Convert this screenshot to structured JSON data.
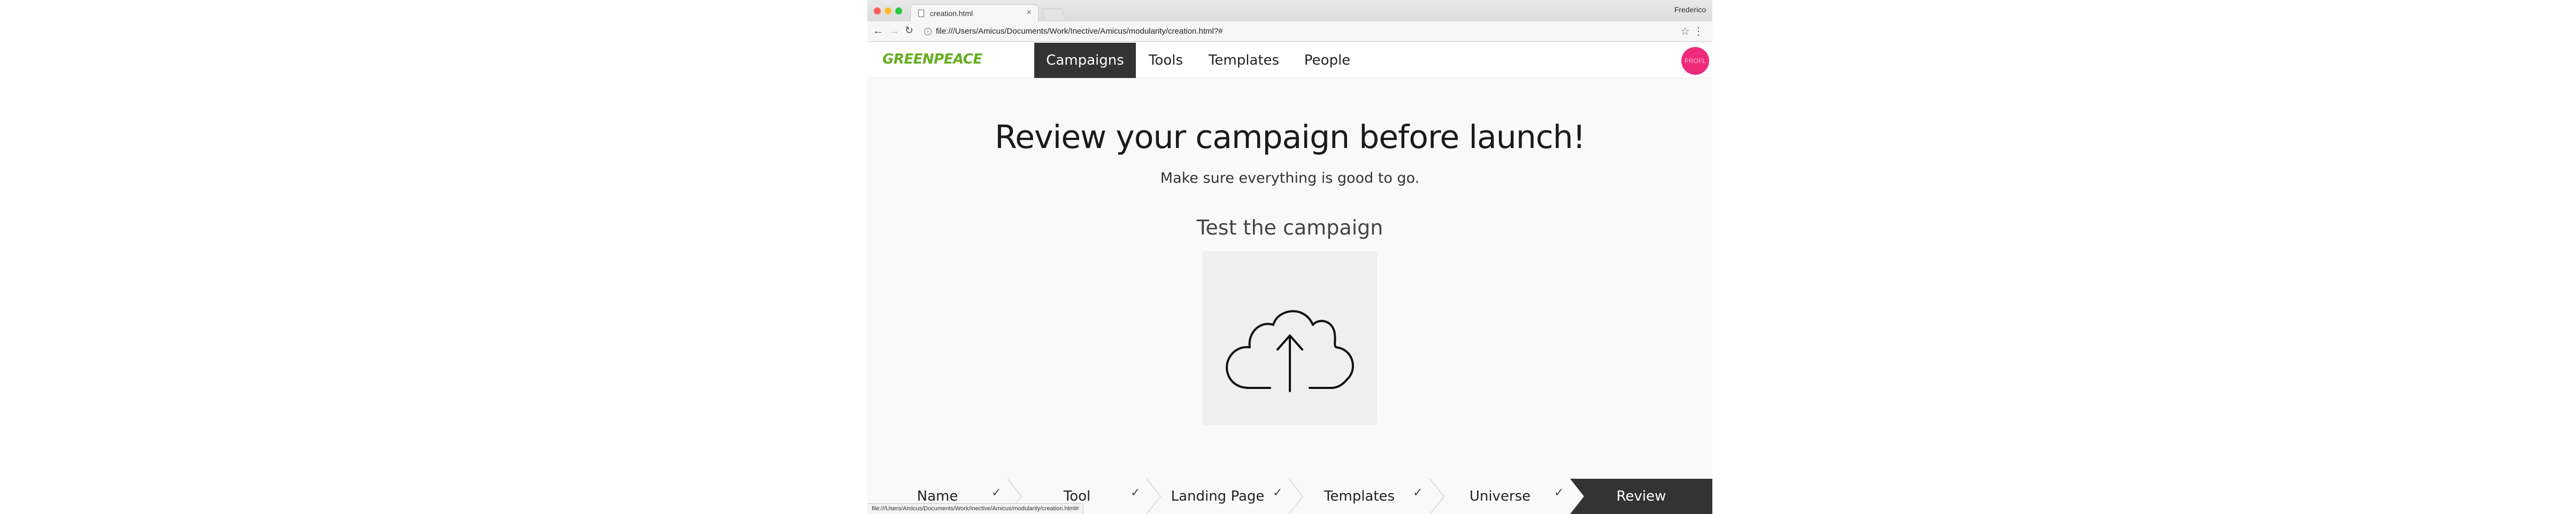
{
  "browser": {
    "tab_title": "creation.html",
    "tab_close": "×",
    "profile": "Frederico",
    "url": "file:///Users/Amicus/Documents/Work/Inective/Amicus/modularity/creation.html?#",
    "info": "i",
    "back": "←",
    "forward": "→",
    "reload": "↻",
    "star": "☆",
    "menu": "⋮",
    "status_url": "file:///Users/Amicus/Documents/Work/Inective/Amicus/modularity/creation.html#"
  },
  "header": {
    "logo": "GREENPEACE",
    "nav": [
      "Campaigns",
      "Tools",
      "Templates",
      "People"
    ],
    "active_nav": "Campaigns",
    "avatar_text": "PROFL"
  },
  "main": {
    "headline": "Review your campaign before launch!",
    "subheadline": "Make sure everything is good to go.",
    "section_title": "Test the campaign",
    "upload_icon": "cloud-upload-icon"
  },
  "stepper": {
    "steps": [
      {
        "label": "Name",
        "done": true
      },
      {
        "label": "Tool",
        "done": true
      },
      {
        "label": "Landing Page",
        "done": true
      },
      {
        "label": "Templates",
        "done": true
      },
      {
        "label": "Universe",
        "done": true
      },
      {
        "label": "Review",
        "done": false
      }
    ],
    "check_glyph": "✓",
    "active_step": "Review"
  },
  "colors": {
    "brand_green": "#65ad1f",
    "active_dark": "#333333",
    "avatar_pink": "#ee2a7b",
    "background": "#f9f9f9"
  }
}
